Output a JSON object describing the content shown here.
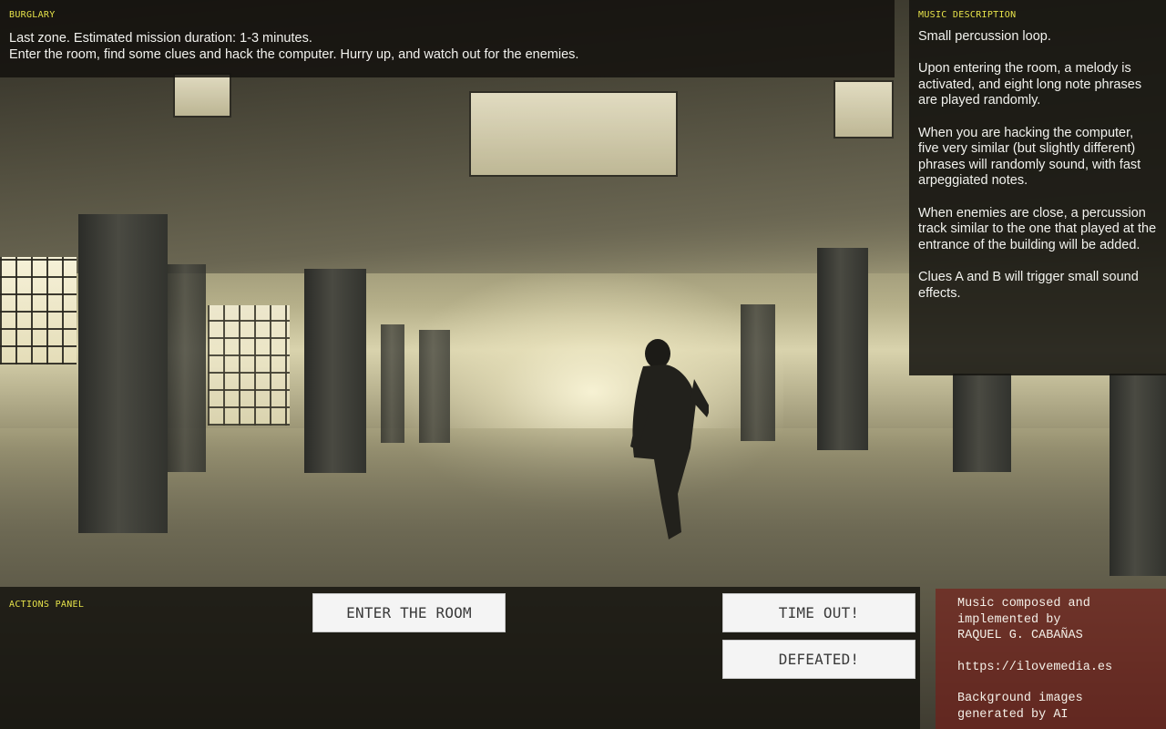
{
  "mission": {
    "label": "BURGLARY",
    "line1": "Last zone. Estimated mission duration: 1-3 minutes.",
    "line2": "Enter the room, find some clues and hack the computer. Hurry up, and watch out for the enemies."
  },
  "music": {
    "label": "MUSIC DESCRIPTION",
    "paragraphs": [
      "Small percussion loop.",
      "Upon entering the room, a melody is activated, and eight long note phrases are played randomly.",
      "When you are hacking the computer, five very similar (but slightly different) phrases will randomly sound, with fast arpeggiated notes.",
      "When enemies are close, a percussion track similar to the one that played at the entrance of the building will be added.",
      "Clues A and B will trigger small sound effects."
    ]
  },
  "actions": {
    "label": "ACTIONS PANEL",
    "enter_label": "ENTER THE ROOM",
    "timeout_label": "TIME OUT!",
    "defeated_label": "DEFEATED!"
  },
  "credits": {
    "line1": "Music composed and",
    "line2": "implemented by",
    "line3": "RAQUEL G. CABAÑAS",
    "link": "https://ilovemedia.es",
    "line4": "Background images",
    "line5": "generated by AI"
  },
  "colors": {
    "label_yellow": "#e6e24a",
    "credits_red": "#781c16",
    "button_bg": "#f4f4f4"
  }
}
